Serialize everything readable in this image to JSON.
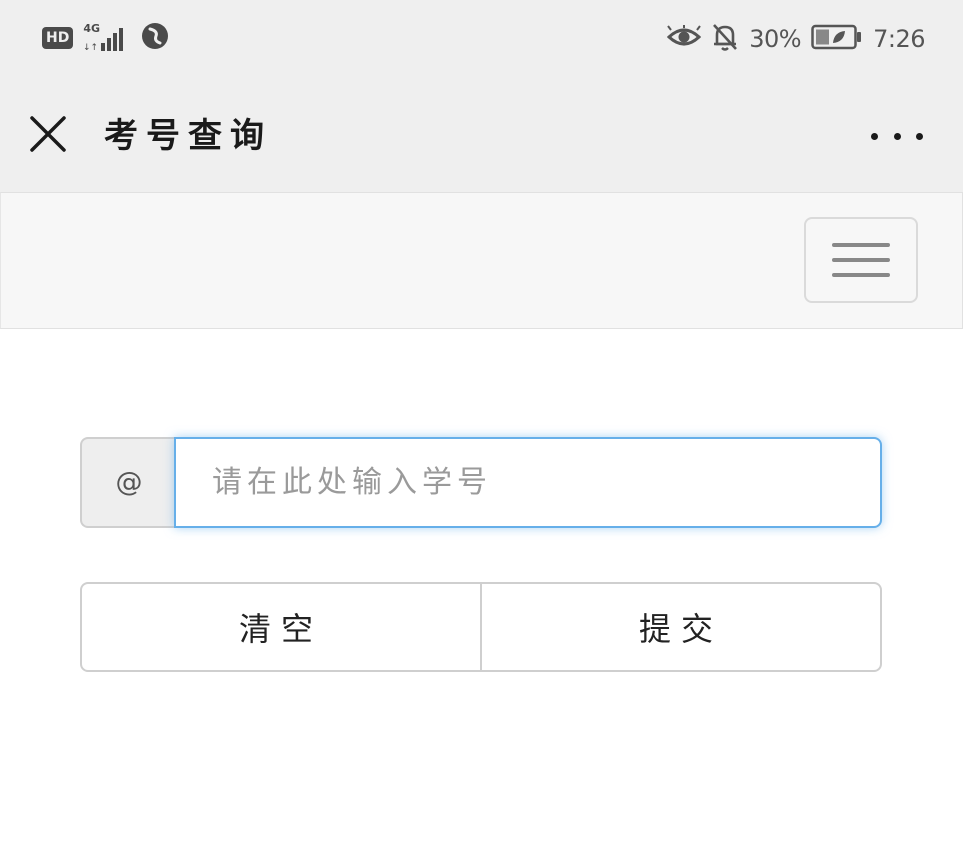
{
  "status_bar": {
    "hd_label": "HD",
    "network_label": "4G",
    "battery_percent_text": "30%",
    "time": "7:26",
    "icons": [
      "signal-icon",
      "vpn-icon",
      "eye-icon",
      "bell-off-icon",
      "battery-icon"
    ]
  },
  "title_bar": {
    "title": "考号查询",
    "close_icon": "close-icon",
    "more_icon": "more-icon"
  },
  "navbar": {
    "menu_icon": "hamburger-menu-icon"
  },
  "form": {
    "addon_symbol": "@",
    "input_value": "",
    "input_placeholder": "请在此处输入学号",
    "clear_label": "清空",
    "submit_label": "提交"
  },
  "colors": {
    "status_bar_bg": "#efefef",
    "navbar_bg": "#f7f7f7",
    "input_focus_border": "#66afe9",
    "addon_bg": "#eeeeee",
    "button_border": "#cfcfcf"
  }
}
